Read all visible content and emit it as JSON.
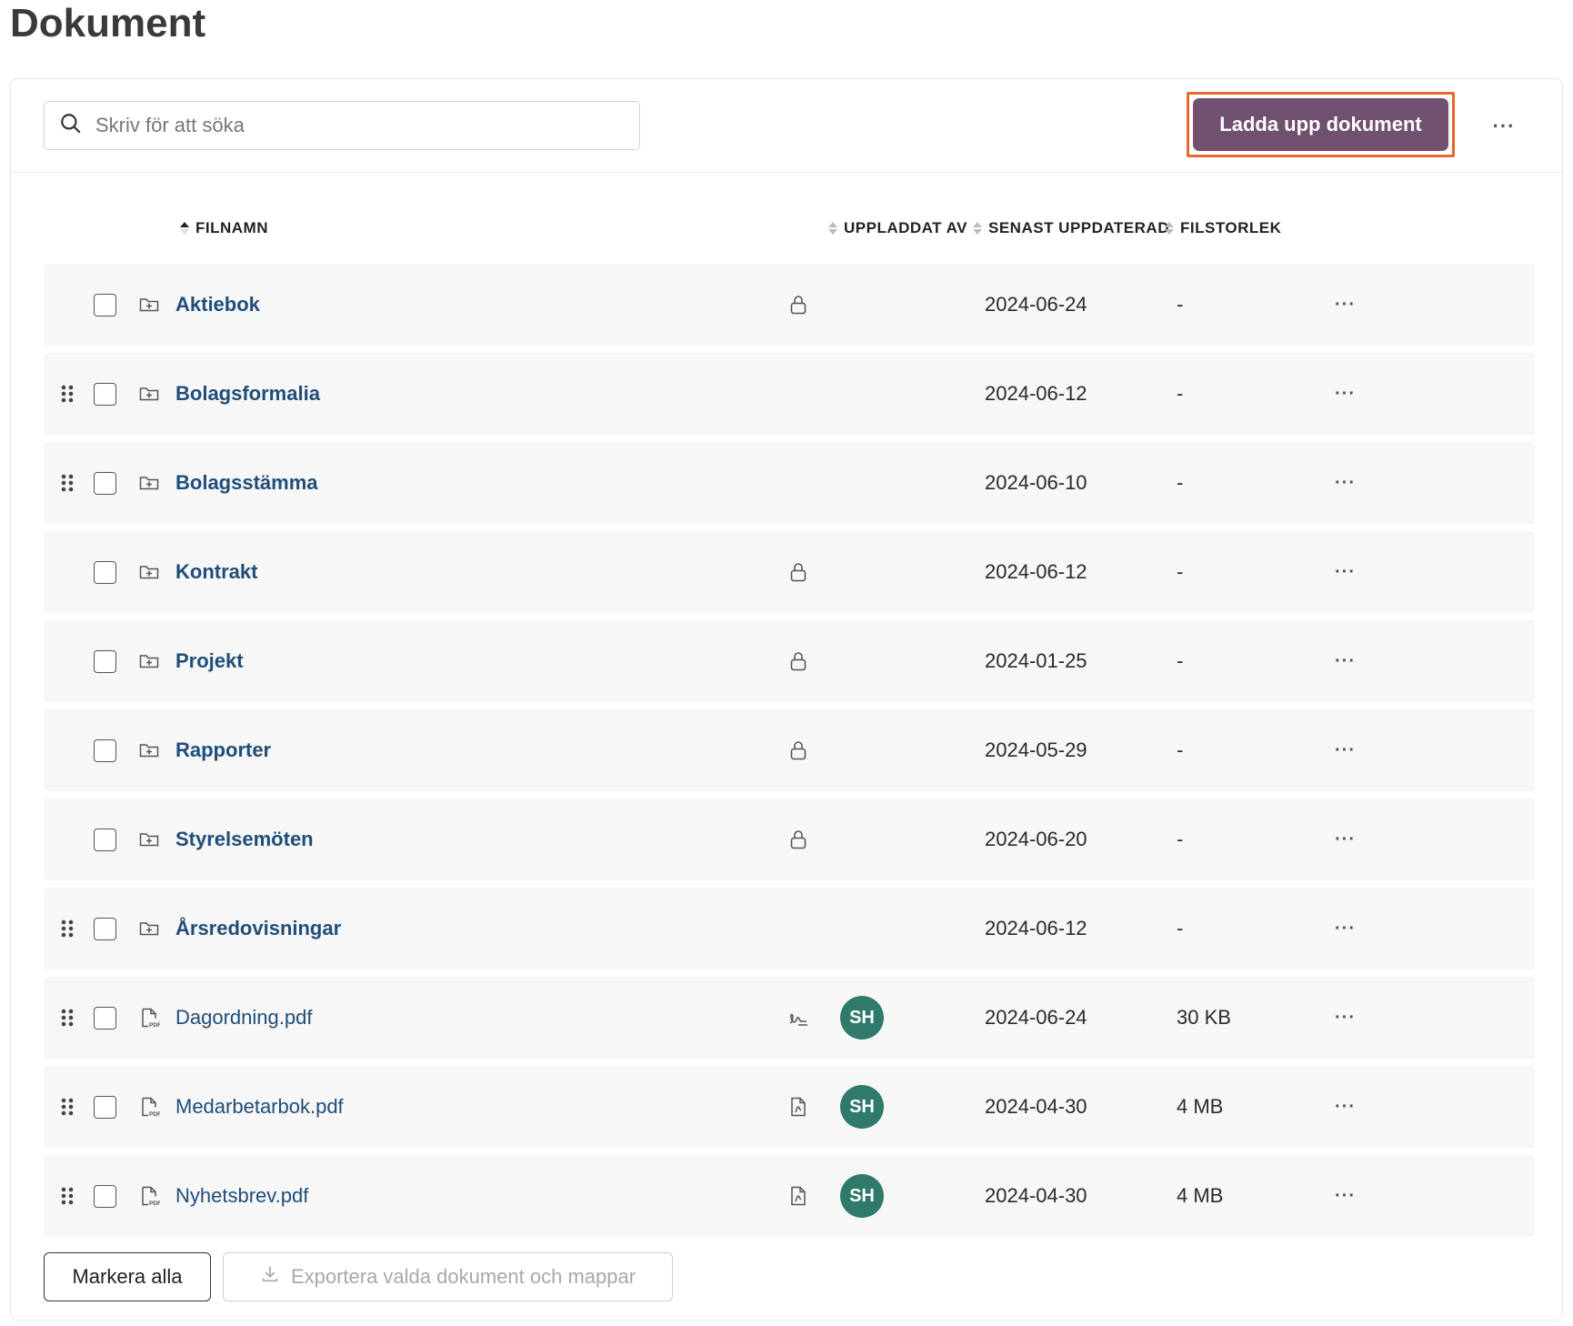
{
  "page": {
    "title": "Dokument"
  },
  "toolbar": {
    "search_placeholder": "Skriv för att söka",
    "upload_label": "Ladda upp dokument",
    "more_label": "···"
  },
  "columns": {
    "filename": "FILNAMN",
    "uploaded_by": "UPPLADDAT AV",
    "updated": "SENAST UPPDATERAD",
    "size": "FILSTORLEK"
  },
  "rows": [
    {
      "name": "Aktiebok",
      "type": "folder",
      "draggable": false,
      "status": "lock",
      "uploader": "",
      "date": "2024-06-24",
      "size": "-"
    },
    {
      "name": "Bolagsformalia",
      "type": "folder",
      "draggable": true,
      "status": "",
      "uploader": "",
      "date": "2024-06-12",
      "size": "-"
    },
    {
      "name": "Bolagsstämma",
      "type": "folder",
      "draggable": true,
      "status": "",
      "uploader": "",
      "date": "2024-06-10",
      "size": "-"
    },
    {
      "name": "Kontrakt",
      "type": "folder",
      "draggable": false,
      "status": "lock",
      "uploader": "",
      "date": "2024-06-12",
      "size": "-"
    },
    {
      "name": "Projekt",
      "type": "folder",
      "draggable": false,
      "status": "lock",
      "uploader": "",
      "date": "2024-01-25",
      "size": "-"
    },
    {
      "name": "Rapporter",
      "type": "folder",
      "draggable": false,
      "status": "lock",
      "uploader": "",
      "date": "2024-05-29",
      "size": "-"
    },
    {
      "name": "Styrelsemöten",
      "type": "folder",
      "draggable": false,
      "status": "lock",
      "uploader": "",
      "date": "2024-06-20",
      "size": "-"
    },
    {
      "name": "Årsredovisningar",
      "type": "folder",
      "draggable": true,
      "status": "",
      "uploader": "",
      "date": "2024-06-12",
      "size": "-"
    },
    {
      "name": "Dagordning.pdf",
      "type": "pdf",
      "draggable": true,
      "status": "signature",
      "uploader": "SH",
      "date": "2024-06-24",
      "size": "30 KB"
    },
    {
      "name": "Medarbetarbok.pdf",
      "type": "pdf",
      "draggable": true,
      "status": "document",
      "uploader": "SH",
      "date": "2024-04-30",
      "size": "4 MB"
    },
    {
      "name": "Nyhetsbrev.pdf",
      "type": "pdf",
      "draggable": true,
      "status": "document",
      "uploader": "SH",
      "date": "2024-04-30",
      "size": "4 MB"
    }
  ],
  "row_more_label": "···",
  "footer": {
    "select_all": "Markera alla",
    "export": "Exportera valda dokument och mappar"
  },
  "colors": {
    "accent": "#72506f",
    "highlight": "#e8682c",
    "avatar": "#2f7a6b",
    "link": "#1f4e79"
  }
}
